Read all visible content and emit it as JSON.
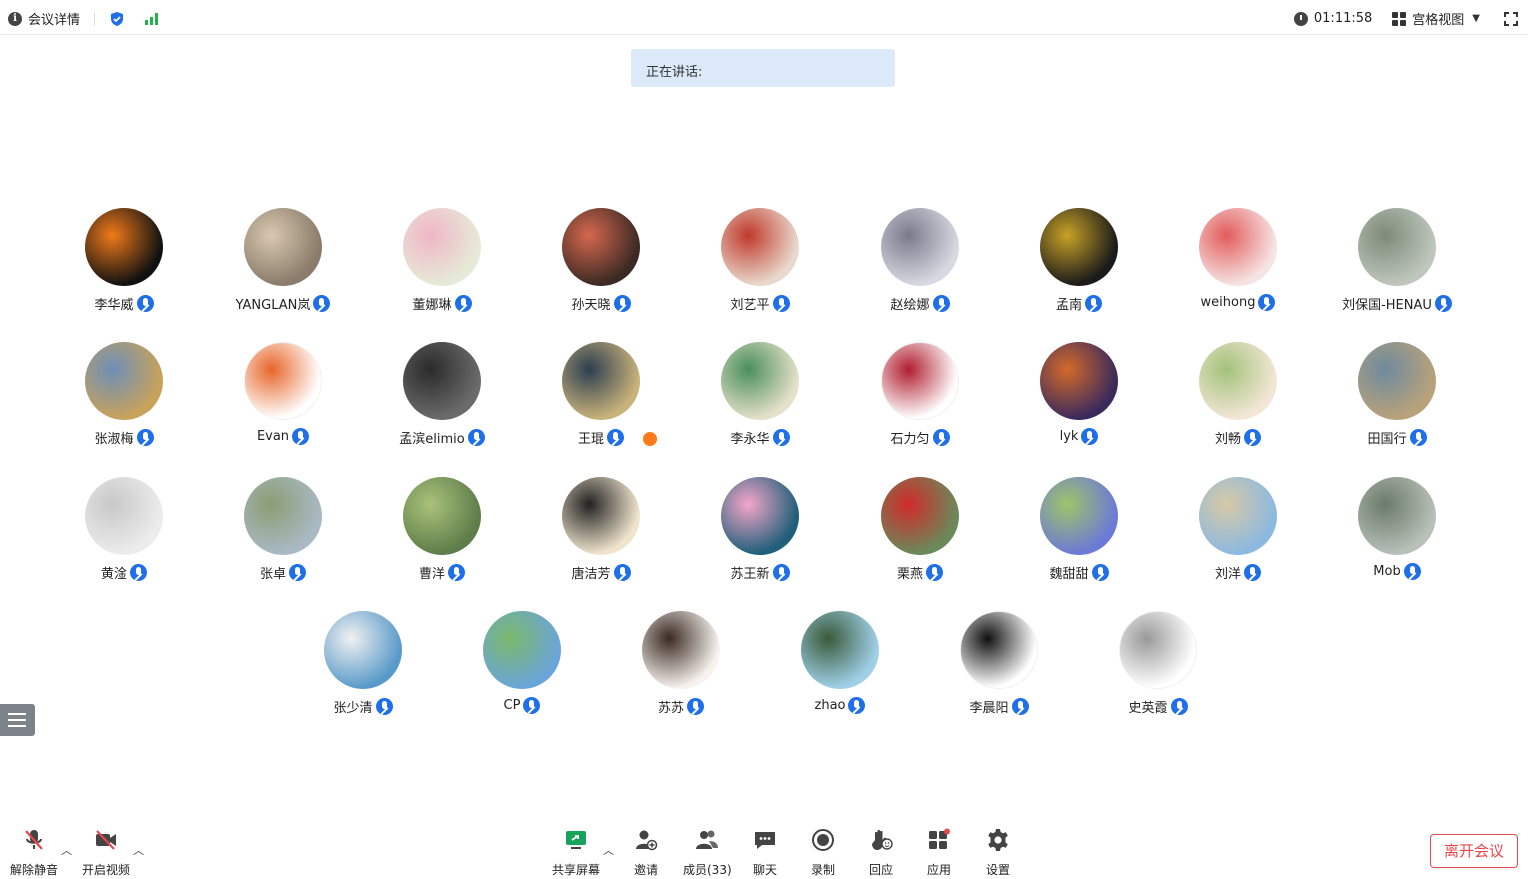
{
  "topbar": {
    "meeting_details": "会议详情",
    "timer": "01:11:58",
    "view_mode": "宫格视图"
  },
  "speaking_label": "正在讲话:",
  "participants": [
    {
      "name": "李华威",
      "color": "#111111",
      "accent": "#f07a1a",
      "mic": true
    },
    {
      "name": "YANGLAN岚",
      "color": "#8a7b6a",
      "accent": "#d8c8b0",
      "mic": true
    },
    {
      "name": "董娜琳",
      "color": "#e6ead8",
      "accent": "#f0b6c6",
      "mic": true
    },
    {
      "name": "孙天晓",
      "color": "#3b2a24",
      "accent": "#d6674e",
      "mic": true
    },
    {
      "name": "刘艺平",
      "color": "#e8d9cc",
      "accent": "#c0392b",
      "mic": true
    },
    {
      "name": "赵绘娜",
      "color": "#d8d8e2",
      "accent": "#7a7a8a",
      "mic": true
    },
    {
      "name": "孟南",
      "color": "#1a1a1a",
      "accent": "#c9a227",
      "mic": true
    },
    {
      "name": "weihong",
      "color": "#f6e4e4",
      "accent": "#e35b5b",
      "mic": true
    },
    {
      "name": "刘保国-HENAU",
      "color": "#bfc6bd",
      "accent": "#7d8a78",
      "mic": true
    },
    {
      "name": "张淑梅",
      "color": "#c9a25a",
      "accent": "#6d8fb8",
      "mic": true
    },
    {
      "name": "Evan",
      "color": "#ffffff",
      "accent": "#e8662a",
      "mic": true
    },
    {
      "name": "孟滨elimio",
      "color": "#6b6b6b",
      "accent": "#2a2a2a",
      "mic": true
    },
    {
      "name": "王琨",
      "color": "#c9b27a",
      "accent": "#2c3e50",
      "mic": true,
      "host": true
    },
    {
      "name": "李永华",
      "color": "#e4e0c9",
      "accent": "#4a8f5a",
      "mic": true
    },
    {
      "name": "石力匀",
      "color": "#ffffff",
      "accent": "#b01e2f",
      "mic": true
    },
    {
      "name": "lyk",
      "color": "#3a2a5c",
      "accent": "#d46a2a",
      "mic": true
    },
    {
      "name": "刘畅",
      "color": "#f3e6d6",
      "accent": "#a3c27a",
      "mic": true
    },
    {
      "name": "田国行",
      "color": "#b9a27a",
      "accent": "#6e8a9e",
      "mic": true
    },
    {
      "name": "黄淦",
      "color": "#ececec",
      "accent": "#c8c8c8",
      "mic": true
    },
    {
      "name": "张卓",
      "color": "#a9b9c4",
      "accent": "#8c9d74",
      "mic": true
    },
    {
      "name": "曹洋",
      "color": "#5f7d4a",
      "accent": "#a9c27a",
      "mic": true
    },
    {
      "name": "唐洁芳",
      "color": "#efe4cc",
      "accent": "#222222",
      "mic": true
    },
    {
      "name": "苏王新",
      "color": "#1f5f7a",
      "accent": "#f4a6c9",
      "mic": true
    },
    {
      "name": "栗燕",
      "color": "#6a8a5a",
      "accent": "#d02a2a",
      "mic": true
    },
    {
      "name": "魏甜甜",
      "color": "#6b7ad6",
      "accent": "#9fc46a",
      "mic": true
    },
    {
      "name": "刘洋",
      "color": "#8cb9e0",
      "accent": "#d7c9a6",
      "mic": true
    },
    {
      "name": "Mob",
      "color": "#b8c0b8",
      "accent": "#6a7a6a",
      "mic": true
    },
    {
      "name": "张少清",
      "color": "#5a9ac9",
      "accent": "#f1f1f1",
      "mic": true
    },
    {
      "name": "CP",
      "color": "#6aa5d9",
      "accent": "#7ab86a",
      "mic": true
    },
    {
      "name": "苏苏",
      "color": "#f7f2ee",
      "accent": "#3a2a22",
      "mic": true
    },
    {
      "name": "zhao",
      "color": "#9fd0e8",
      "accent": "#3a5a3a",
      "mic": true
    },
    {
      "name": "李晨阳",
      "color": "#ffffff",
      "accent": "#111111",
      "mic": true
    },
    {
      "name": "史英霞",
      "color": "#ffffff",
      "accent": "#999999",
      "mic": true
    }
  ],
  "toolbar": {
    "unmute": "解除静音",
    "start_video": "开启视频",
    "share_screen": "共享屏幕",
    "invite": "邀请",
    "members": "成员(33)",
    "chat": "聊天",
    "record": "录制",
    "react": "回应",
    "apps": "应用",
    "settings": "设置",
    "leave": "离开会议"
  }
}
